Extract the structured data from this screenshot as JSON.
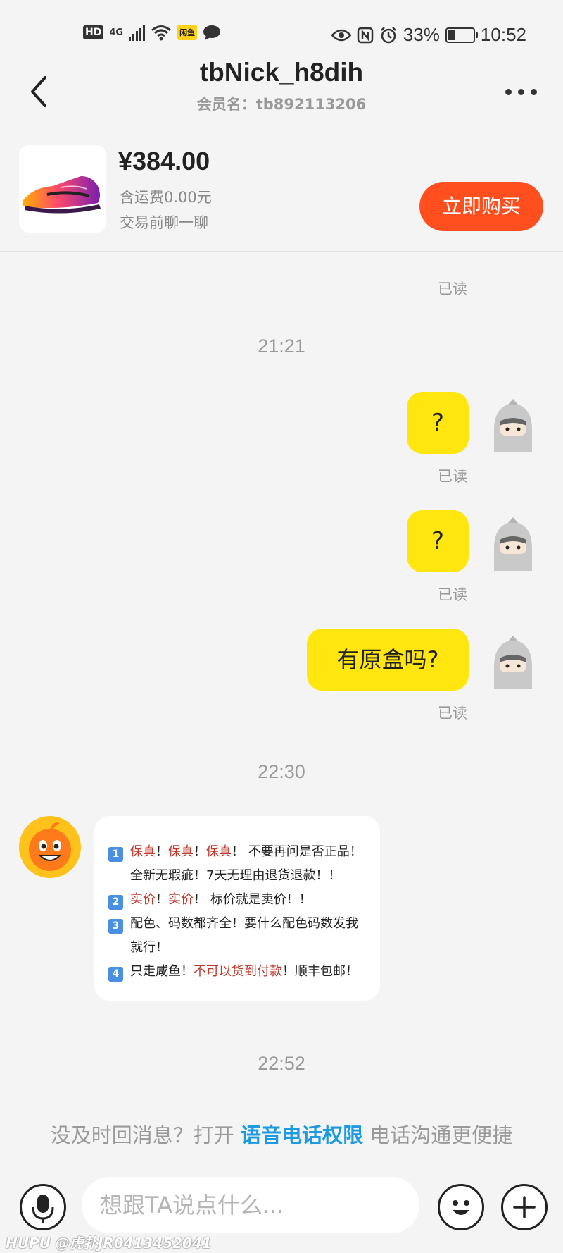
{
  "status_bar": {
    "hd": "HD",
    "network": "4G",
    "app_badge": "闲鱼",
    "battery": "33%",
    "time": "10:52"
  },
  "header": {
    "title": "tbNick_h8dih",
    "subtitle": "会员名：tb892113206"
  },
  "product": {
    "price": "¥384.00",
    "shipping": "含运费0.00元",
    "chat_hint": "交易前聊一聊",
    "buy_label": "立即购买"
  },
  "messages": {
    "read_label": "已读",
    "time_1": "21:21",
    "msg_1": "?",
    "msg_2": "?",
    "msg_3": "有原盒吗?",
    "time_2": "22:30",
    "time_3": "22:52"
  },
  "system_card": {
    "n1": "1",
    "n2": "2",
    "n3": "3",
    "n4": "4",
    "l1_red_a": "保真",
    "l1_sep_a": "！",
    "l1_red_b": "保真",
    "l1_sep_b": "！",
    "l1_red_c": "保真",
    "l1_rest": "！ 不要再问是否正品！",
    "l1_cont": "全新无瑕疵！7天无理由退货退款！！",
    "l2_red_a": "实价",
    "l2_sep": "！",
    "l2_red_b": "实价",
    "l2_rest": "！ 标价就是卖价！！",
    "l3": "配色、码数都齐全！要什么配色码数发我",
    "l3_cont": "就行！",
    "l4_a": "只走咸鱼！",
    "l4_red": "不可以货到付款",
    "l4_b": "！顺丰包邮！"
  },
  "notice": {
    "before": "没及时回消息？打开 ",
    "link": "语音电话权限",
    "after": " 电话沟通更便捷"
  },
  "input": {
    "placeholder": "想跟TA说点什么..."
  },
  "watermark": "HUPU @虎扑JR0413452041",
  "colors": {
    "bubble": "#ffe60f",
    "buy_button": "#ff4f1f",
    "link": "#1e9be0",
    "highlight": "#c0392b"
  }
}
